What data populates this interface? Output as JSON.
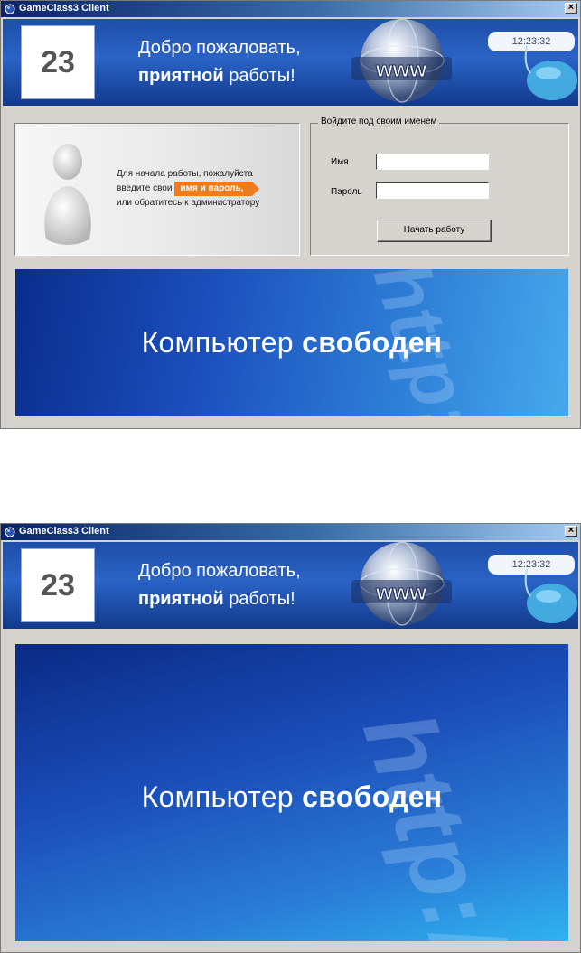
{
  "window": {
    "title": "GameClass3 Client",
    "close_label": "×"
  },
  "banner": {
    "station_number": "23",
    "welcome_line1": "Добро пожаловать,",
    "welcome_bold": "приятной",
    "welcome_rest": "работы!",
    "clock": "12:23:32",
    "globe_text": "www"
  },
  "info": {
    "line1": "Для начала работы, пожалуйста",
    "line2_prefix": "введите  свои",
    "line2_highlight": "имя и пароль,",
    "line3": "или обратитесь к администратору"
  },
  "login": {
    "legend": "Войдите под своим именем",
    "name_label": "Имя",
    "name_value": "",
    "password_label": "Пароль",
    "password_value": "",
    "submit_label": "Начать работу"
  },
  "status": {
    "text_regular": "Компьютер",
    "text_bold": "свободен",
    "watermark": "http://"
  },
  "colors": {
    "title_bar": "#0a246a",
    "window_bg": "#d6d3ce",
    "accent_orange": "#f07b1c",
    "status_blue": "#1c4fbd"
  }
}
